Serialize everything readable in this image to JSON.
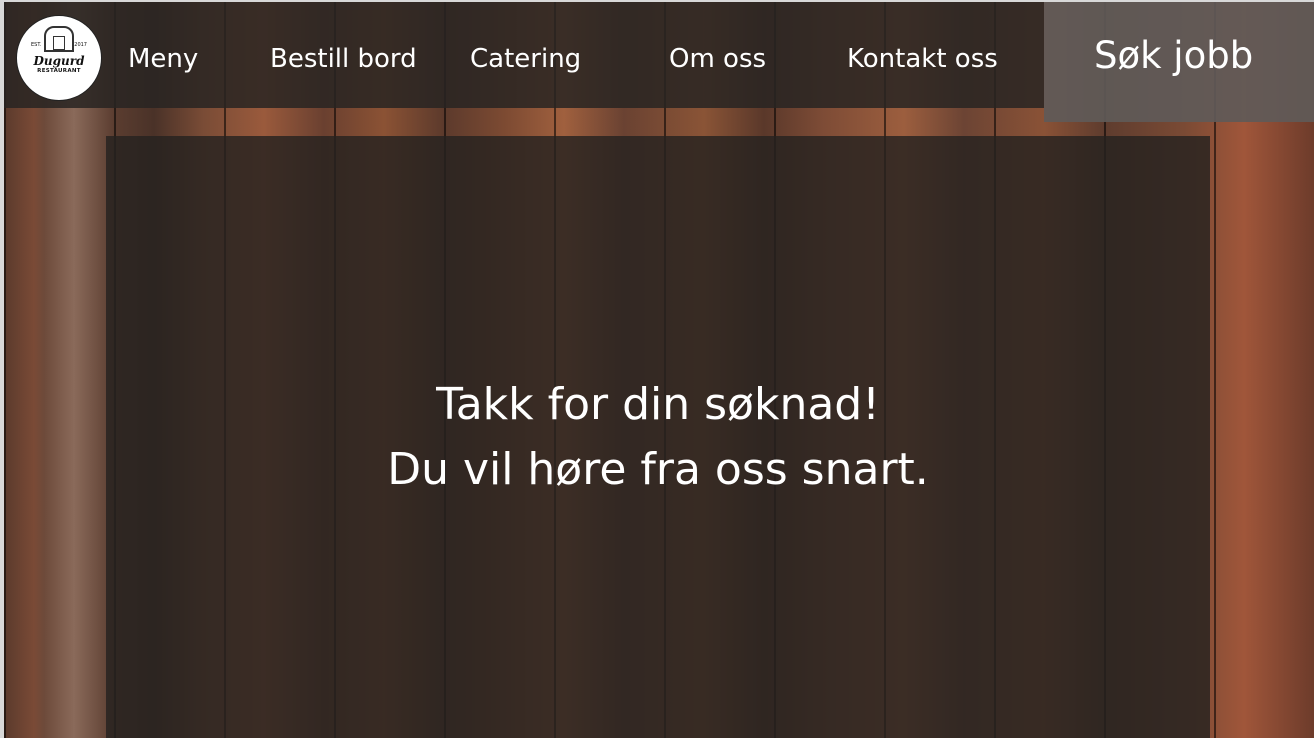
{
  "logo": {
    "est": "EST.",
    "year": "2017",
    "name": "Dugurd",
    "subtitle": "RESTAURANT"
  },
  "nav": {
    "items": [
      {
        "label": "Meny"
      },
      {
        "label": "Bestill bord"
      },
      {
        "label": "Catering"
      },
      {
        "label": "Om oss"
      },
      {
        "label": "Kontakt oss"
      },
      {
        "label": "Søk jobb"
      }
    ],
    "active_index": 5
  },
  "main": {
    "line1": "Takk for din søknad!",
    "line2": "Du vil høre fra oss snart."
  }
}
